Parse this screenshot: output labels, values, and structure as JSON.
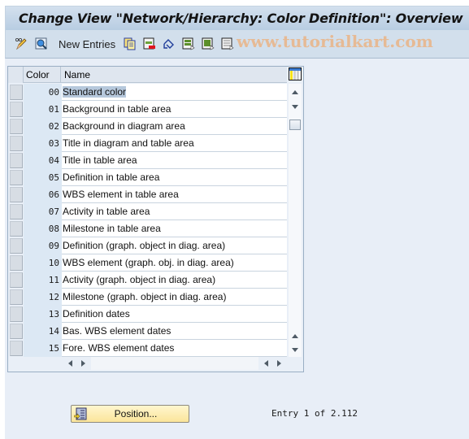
{
  "window": {
    "title": "Change View \"Network/Hierarchy: Color Definition\": Overview"
  },
  "toolbar": {
    "items": [
      {
        "name": "display-change-icon",
        "tooltip": ""
      },
      {
        "name": "details-icon",
        "tooltip": ""
      }
    ],
    "new_entries_label": "New Entries",
    "icons": [
      "copy-as-icon",
      "delete-icon",
      "undo-change-icon",
      "select-all-icon",
      "select-block-icon",
      "deselect-all-icon"
    ],
    "watermark": "www.tutorialkart.com"
  },
  "table": {
    "columns": {
      "color": "Color",
      "name": "Name"
    },
    "rows": [
      {
        "color": "00",
        "name": "Standard color",
        "selected": true
      },
      {
        "color": "01",
        "name": "Background in table area"
      },
      {
        "color": "02",
        "name": "Background in diagram area"
      },
      {
        "color": "03",
        "name": "Title in diagram and table area"
      },
      {
        "color": "04",
        "name": "Title in table area"
      },
      {
        "color": "05",
        "name": "Definition in table area"
      },
      {
        "color": "06",
        "name": "WBS element in table area"
      },
      {
        "color": "07",
        "name": "Activity in table area"
      },
      {
        "color": "08",
        "name": "Milestone in table area"
      },
      {
        "color": "09",
        "name": "Definition (graph. object in diag. area)"
      },
      {
        "color": "10",
        "name": "WBS element (graph. obj. in diag. area)"
      },
      {
        "color": "11",
        "name": "Activity (graph. object in diag. area)"
      },
      {
        "color": "12",
        "name": "Milestone (graph. object in diag. area)"
      },
      {
        "color": "13",
        "name": "Definition dates"
      },
      {
        "color": "14",
        "name": "Bas. WBS element dates"
      },
      {
        "color": "15",
        "name": "Fore. WBS element dates"
      }
    ]
  },
  "footer": {
    "position_label": "Position...",
    "entry_info": "Entry 1 of 2.112"
  },
  "colors": {
    "background": "#e8eef7",
    "title_bar": "#c6d6e8",
    "position_button": "#fbe8a6",
    "selection_highlight": "#b6c8dc"
  }
}
